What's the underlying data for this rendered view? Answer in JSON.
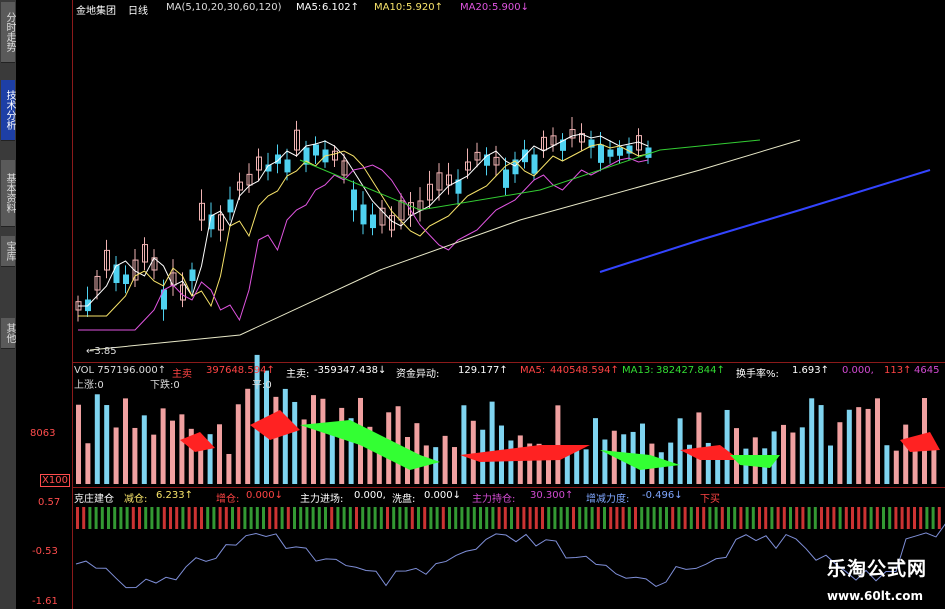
{
  "sidebar": {
    "tabs": [
      {
        "label": "分时走势",
        "active": false
      },
      {
        "label": "技术分析",
        "active": true
      },
      {
        "label": "基本资料",
        "active": false
      },
      {
        "label": "宝库",
        "active": false
      },
      {
        "label": "其他",
        "active": false
      }
    ]
  },
  "price_panel": {
    "stock_name": "金地集团",
    "period": "日线",
    "ma_params": "MA(5,10,20,30,60,120)",
    "ma5_label": "MA5:",
    "ma5_value": "6.102↑",
    "ma10_label": "MA10:",
    "ma10_value": "5.920↑",
    "ma20_label": "MA20:",
    "ma20_value": "5.900↓",
    "low_marker": "←3.85"
  },
  "volume_panel": {
    "vol_label": "VOL 757196.000↑",
    "zhumai_label": "主卖",
    "zhumai_value": "397648.594↑",
    "zhumai2_label": "主卖:",
    "zhumai2_value": "-359347.438↓",
    "zijin_label": "资金异动:",
    "zijin_value": "129.177↑",
    "ma5_label": "MA5:",
    "ma5_value": "440548.594↑",
    "ma13_label": "MA13:",
    "ma13_value": "382427.844↑",
    "hsl_label": "换手率%:",
    "hsl_value": "1.693↑",
    "zero1": "0.000,",
    "val113": "113↑",
    "val4645": "4645",
    "shang_zhang": "上涨:0",
    "xia_die": "下跌:0",
    "ping": "平:0",
    "axis_top": "8063",
    "axis_unit": "X100"
  },
  "indicator_panel": {
    "name": "克庄建仓",
    "jiancang_label": "减仓:",
    "jiancang_value": "6.233↑",
    "zengcang_label": "增仓:",
    "zengcang_value": "0.000↓",
    "zhuli_label": "主力进场:",
    "zhuli_value": "0.000,",
    "xipan_label": "洗盘:",
    "xipan_value": "0.000↓",
    "chicang_label": "主力持仓:",
    "chicang_value": "30.300↑",
    "zengjian_label": "增减力度:",
    "zengjian_value": "-0.496↓",
    "xiamai": "下买",
    "axis_top": "0.57",
    "axis_mid": "-0.53",
    "axis_bot": "-1.61"
  },
  "watermark": {
    "title": "乐淘公式网",
    "url": "www.60lt.com"
  }
}
